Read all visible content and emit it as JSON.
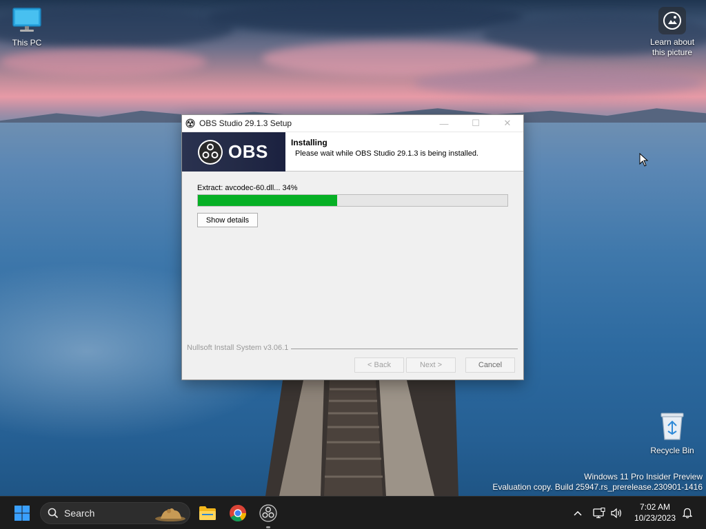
{
  "desktop": {
    "icons": {
      "this_pc": "This PC",
      "learn_line1": "Learn about",
      "learn_line2": "this picture",
      "recycle_bin": "Recycle Bin"
    },
    "watermark": {
      "line1": "Windows 11 Pro Insider Preview",
      "line2": "Evaluation copy. Build 25947.rs_prerelease.230901-1416"
    }
  },
  "installer": {
    "window_title": "OBS Studio 29.1.3 Setup",
    "banner_logo_text": "OBS",
    "header_title": "Installing",
    "header_subtitle": "Please wait while OBS Studio 29.1.3 is being installed.",
    "status_text": "Extract: avcodec-60.dll... 34%",
    "progress_percent": 45,
    "show_details_label": "Show details",
    "branding": "Nullsoft Install System v3.06.1",
    "back_label": "< Back",
    "next_label": "Next >",
    "cancel_label": "Cancel",
    "progress_color": "#06b025"
  },
  "taskbar": {
    "search_placeholder": "Search",
    "pinned_apps": [
      "file-explorer",
      "google-chrome",
      "obs-studio"
    ],
    "clock_time": "7:02 AM",
    "clock_date": "10/23/2023"
  }
}
